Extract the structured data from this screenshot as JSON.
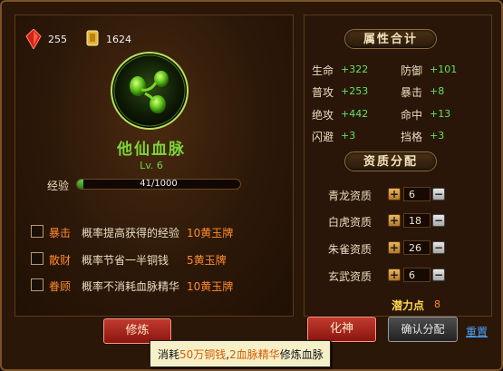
{
  "currency": {
    "gems": "255",
    "gold_tokens": "1624"
  },
  "skill": {
    "name": "他仙血脉",
    "level": "Lv. 6"
  },
  "exp": {
    "label": "经验",
    "text": "41/1000",
    "fraction": 0.041
  },
  "options": [
    {
      "label": "暴击",
      "desc": "概率提高获得的经验",
      "cost": "10黄玉牌"
    },
    {
      "label": "散财",
      "desc": "概率节省一半铜钱",
      "cost": "5黄玉牌"
    },
    {
      "label": "眷顾",
      "desc": "概率不消耗血脉精华",
      "cost": "10黄玉牌"
    }
  ],
  "buttons": {
    "cultivate": "修炼",
    "transform": "化神",
    "confirm": "确认分配",
    "reset": "重置"
  },
  "tooltip": {
    "prefix": "消耗",
    "amount": "50万铜钱",
    "sep": ",",
    "essence": "2血脉精华",
    "suffix": "修炼血脉"
  },
  "attributes": {
    "title": "属性合计",
    "items": [
      {
        "name": "生命",
        "value": "+322"
      },
      {
        "name": "防御",
        "value": "+101"
      },
      {
        "name": "普攻",
        "value": "+253"
      },
      {
        "name": "暴击",
        "value": "+8"
      },
      {
        "name": "绝攻",
        "value": "+442"
      },
      {
        "name": "命中",
        "value": "+13"
      },
      {
        "name": "闪避",
        "value": "+3"
      },
      {
        "name": "挡格",
        "value": "+3"
      }
    ]
  },
  "qualities": {
    "title": "资质分配",
    "items": [
      {
        "name": "青龙资质",
        "value": "6"
      },
      {
        "name": "白虎资质",
        "value": "18"
      },
      {
        "name": "朱雀资质",
        "value": "26"
      },
      {
        "name": "玄武资质",
        "value": "6"
      }
    ],
    "potential_label": "潜力点",
    "potential_value": "8"
  },
  "colors": {
    "accent_green": "#5fe35f",
    "accent_orange": "#ff8a2c",
    "potential_gold": "#ffd94a",
    "button_red": "#b52a20"
  }
}
